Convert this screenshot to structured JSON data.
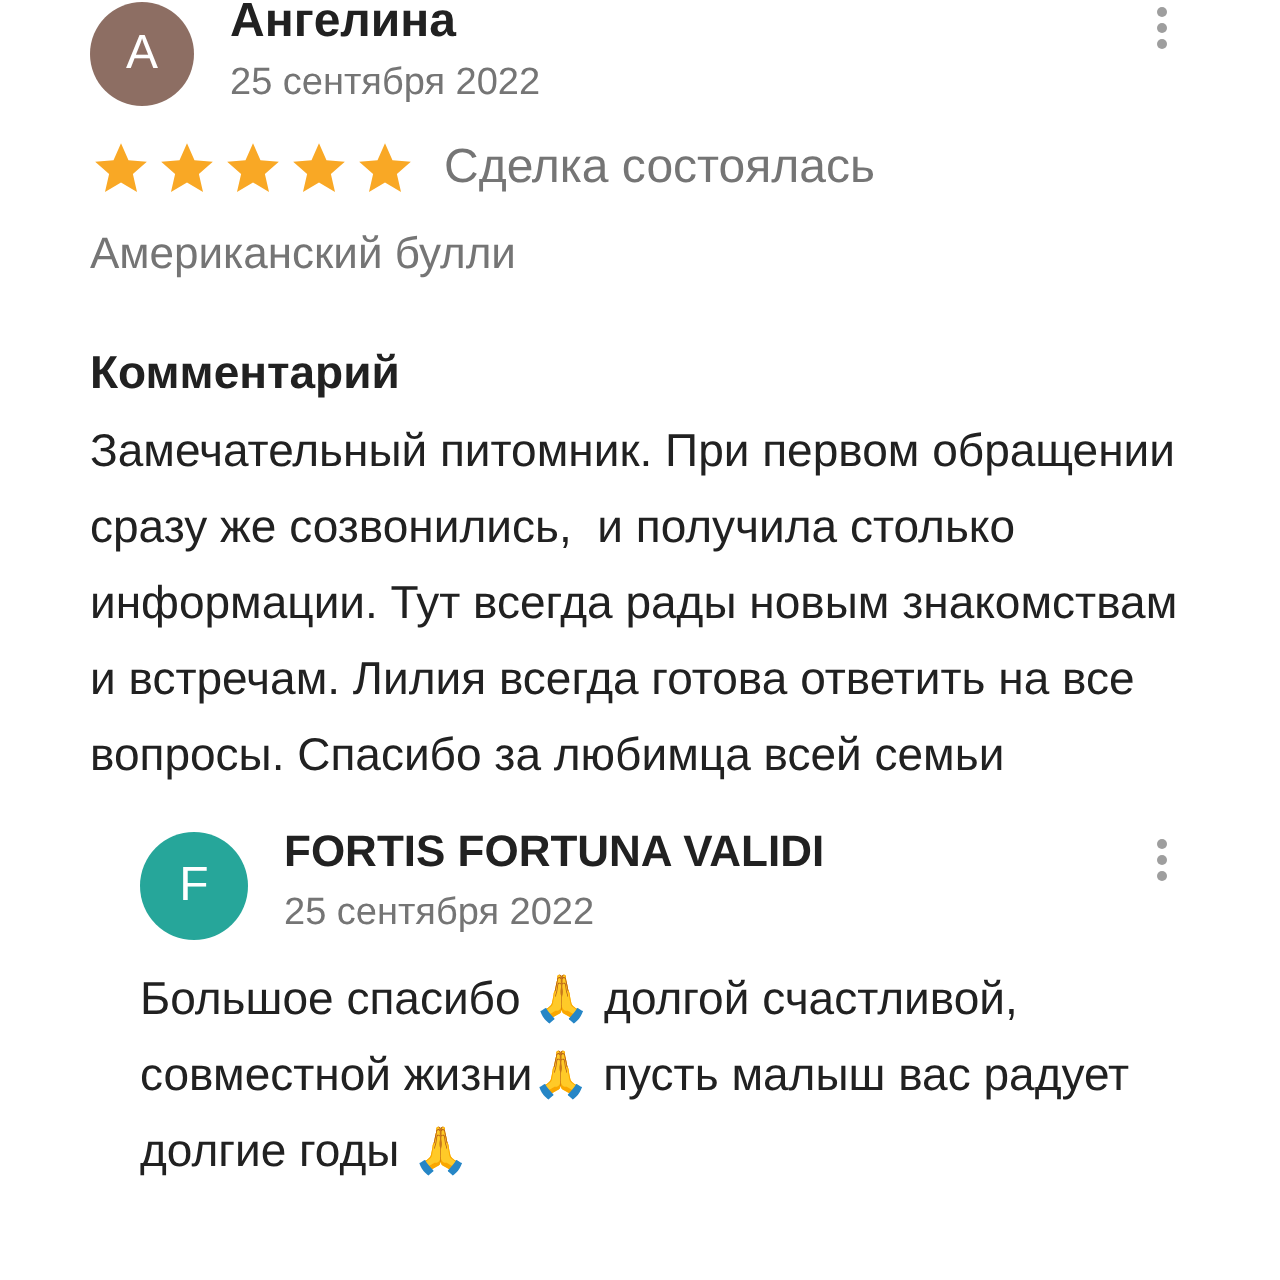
{
  "review": {
    "avatar_letter": "A",
    "author": "Ангелина",
    "date": "25 сентября 2022",
    "stars": 5,
    "status": "Сделка состоялась",
    "breed": "Американский булли",
    "comment_heading": "Комментарий",
    "comment": "Замечательный питомник. При первом обращении сразу же созвонились,  и получила столько информации. Тут всегда рады новым знакомствам и встречам. Лилия всегда готова ответить на все вопросы. Спасибо за любимца всей семьи"
  },
  "reply": {
    "avatar_letter": "F",
    "author": "FORTIS FORTUNA VALIDI",
    "date": "25 сентября 2022",
    "text": "Большое спасибо 🙏 долгой счастливой, совместной жизни🙏 пусть малыш вас радует долгие годы 🙏"
  }
}
